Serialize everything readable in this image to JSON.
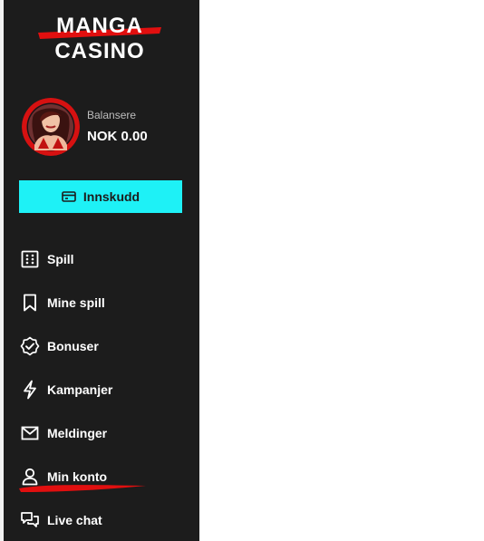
{
  "logo": {
    "line1": "MANGA",
    "line2": "CASINO"
  },
  "profile": {
    "balance_label": "Balansere",
    "balance_value": "NOK 0.00"
  },
  "deposit": {
    "label": "Innskudd",
    "icon": "wallet-icon"
  },
  "nav": {
    "items": [
      {
        "label": "Spill",
        "icon": "games-grid-icon"
      },
      {
        "label": "Mine spill",
        "icon": "bookmark-icon"
      },
      {
        "label": "Bonuser",
        "icon": "badge-check-icon"
      },
      {
        "label": "Kampanjer",
        "icon": "lightning-icon"
      },
      {
        "label": "Meldinger",
        "icon": "envelope-icon"
      },
      {
        "label": "Min konto",
        "icon": "user-icon"
      },
      {
        "label": "Live chat",
        "icon": "chat-bubbles-icon"
      }
    ]
  },
  "colors": {
    "sidebar_bg": "#1c1c1c",
    "accent": "#1ef1f6",
    "brand_red": "#e10f0f",
    "text": "#ffffff",
    "muted_text": "#bdbdbd"
  }
}
